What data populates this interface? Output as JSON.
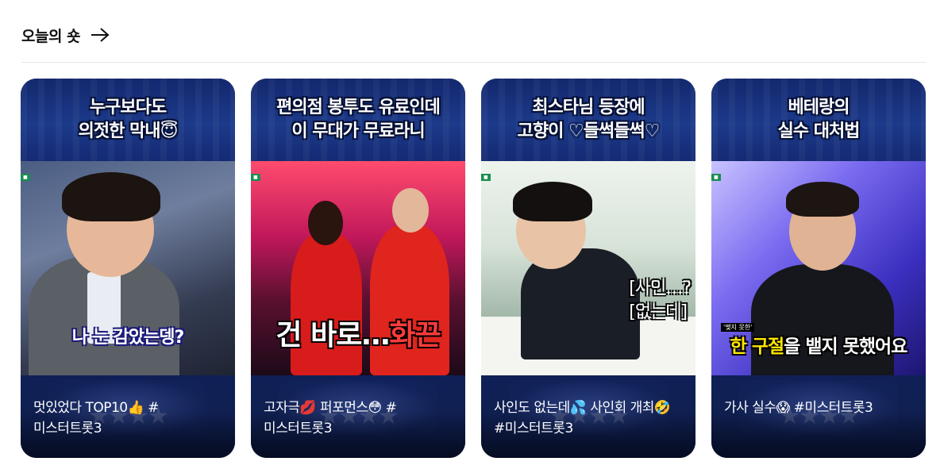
{
  "section": {
    "title": "오늘의 숏",
    "arrow_icon": "arrow-right-icon"
  },
  "cards": [
    {
      "headline_line1": "누구보다도",
      "headline_line2": "의젓한 막내😇",
      "caption": "나 눈 감았는뎅?",
      "title": "멋있었다 TOP10👍 # 미스터트롯3"
    },
    {
      "headline_line1": "편의점 봉투도 유료인데",
      "headline_line2": "이 무대가 무료라니",
      "caption_main": "건 바로…",
      "caption_hot": "화끈",
      "title": "고자극💋 퍼포먼스😳 # 미스터트롯3"
    },
    {
      "headline_line1": "최스타님 등장에",
      "headline_line2": "고향이 ♡들썩들썩♡",
      "caption_line1": "[사인…?",
      "caption_line2": "[없는데]",
      "title": "사인도 없는데💦 사인회 개최🤣 #미스터트롯3"
    },
    {
      "headline_line1": "베테랑의",
      "headline_line2": "실수 대처법",
      "caption_small": "'맺지 못한'",
      "caption_hl": "한 구절",
      "caption_rest": "을 뱉지 못했어요",
      "title": "가사 실수😱 #미스터트롯3"
    }
  ]
}
